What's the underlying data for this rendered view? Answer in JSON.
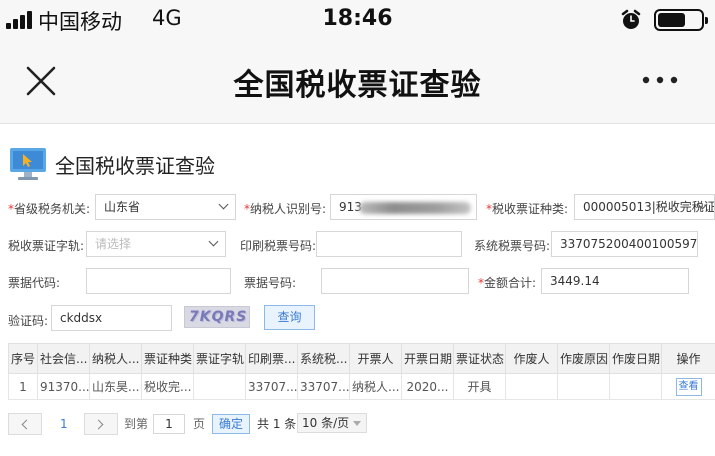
{
  "status_bar": {
    "carrier": "中国移动",
    "network": "4G",
    "time": "18:46"
  },
  "nav": {
    "title": "全国税收票证查验"
  },
  "page": {
    "title": "全国税收票证查验"
  },
  "form": {
    "province_label": "省级税务机关:",
    "province_value": "山东省",
    "taxpayer_id_label": "纳税人识别号:",
    "taxpayer_id_value": "913",
    "voucher_type_label": "税收票证种类:",
    "voucher_type_value": "000005013|税收完税证",
    "voucher_track_label": "税收票证字轨:",
    "voucher_track_placeholder": "请选择",
    "printed_no_label": "印刷税票号码:",
    "system_no_label": "系统税票号码:",
    "system_no_value": "337075200400100597",
    "bill_code_label": "票据代码:",
    "bill_no_label": "票据号码:",
    "amount_label": "金额合计:",
    "amount_value": "3449.14",
    "captcha_label": "验证码:",
    "captcha_value": "ckddsx",
    "captcha_image_text": "7KQRS",
    "query_button": "查询"
  },
  "table": {
    "headers": [
      "序号",
      "社会信...",
      "纳税人...",
      "票证种类",
      "票证字轨",
      "印刷票...",
      "系统税...",
      "开票人",
      "开票日期",
      "票证状态",
      "作废人",
      "作废原因",
      "作废日期",
      "操作"
    ],
    "rows": [
      [
        "1",
        "91370...",
        "山东昊...",
        "税收完...",
        "",
        "33707...",
        "33707...",
        "纳税人...",
        "2020...",
        "开具",
        "",
        "",
        "",
        "查看"
      ]
    ]
  },
  "pagination": {
    "current_page": "1",
    "goto_prefix": "到第",
    "goto_value": "1",
    "goto_suffix": "页",
    "confirm": "确定",
    "total": "共 1 条",
    "page_size": "10 条/页"
  }
}
